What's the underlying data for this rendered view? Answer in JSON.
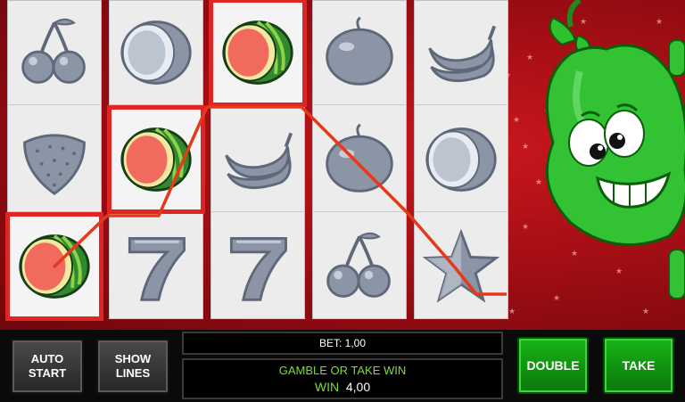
{
  "reels": [
    {
      "id": "reel-1",
      "symbols": [
        "cherries",
        "strawberry",
        "watermelon"
      ]
    },
    {
      "id": "reel-2",
      "symbols": [
        "coconut",
        "watermelon",
        "seven"
      ]
    },
    {
      "id": "reel-3",
      "symbols": [
        "watermelon",
        "banana",
        "seven"
      ]
    },
    {
      "id": "reel-4",
      "symbols": [
        "plum",
        "plum",
        "cherries"
      ]
    },
    {
      "id": "reel-5",
      "symbols": [
        "banana",
        "coconut",
        "star"
      ]
    }
  ],
  "highlighted_symbol": "watermelon",
  "colors": {
    "win_outline": "#e02424",
    "payline": "#e23a1a",
    "background": "#a30e14",
    "button_green": "#13a313"
  },
  "controls": {
    "auto_start": [
      "AUTO",
      "START"
    ],
    "show_lines": [
      "SHOW",
      "LINES"
    ],
    "bet_label": "BET:",
    "bet_value": "1,00",
    "message": "GAMBLE OR TAKE WIN",
    "win_label": "WIN",
    "win_value": "4,00",
    "double_label": "DOUBLE",
    "take_label": "TAKE"
  },
  "mascot": "pear-icon"
}
